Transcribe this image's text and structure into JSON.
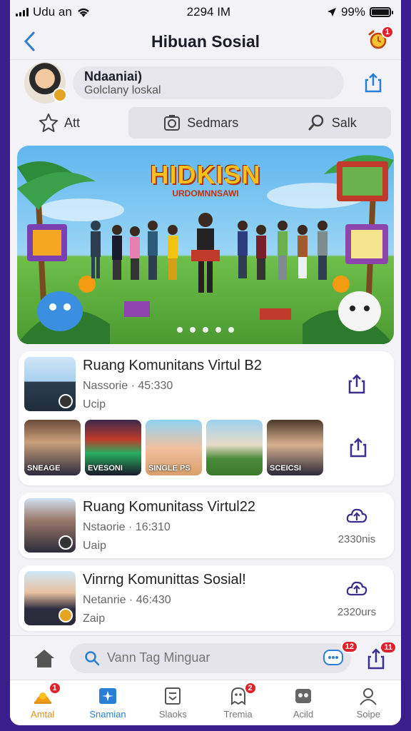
{
  "status": {
    "carrier": "Udu an",
    "time": "2294 IM",
    "battery": "99%",
    "battery_level": 0.99
  },
  "header": {
    "title": "Hibuan Sosial",
    "notif_badge": "1"
  },
  "profile": {
    "name": "Ndaaniai)",
    "subtitle": "Golclany loskal"
  },
  "tabs": {
    "first": "Att",
    "second": "Sedmars",
    "third": "Salk"
  },
  "banner": {
    "title": "HIDKISN",
    "subtitle": "URDOMNNSAWI",
    "slide_count": 5
  },
  "posts": [
    {
      "title": "Ruang Komunitans Virtul B2",
      "meta": "Nassorie · 45:330",
      "sub": "Ucip"
    },
    {
      "title": "Ruang Komunitass Virtul22",
      "meta": "Nstaorie · 16:310",
      "sub": "Uaip",
      "count": "2330nis"
    },
    {
      "title": "Vinrng Komunittas Sosial!",
      "meta": "Netanrie · 46:430",
      "sub": "Zaip",
      "count": "2320urs"
    }
  ],
  "gallery": [
    "SNEAGE",
    "EVESONI",
    "SINGLE PS",
    "",
    "SCEICSI"
  ],
  "search": {
    "placeholder": "Vann Tag Minguar",
    "chat_badge": "12",
    "right_badge": "11"
  },
  "nav": [
    {
      "label": "Amtal",
      "badge": "1"
    },
    {
      "label": "Snamian"
    },
    {
      "label": "Slaoks"
    },
    {
      "label": "Tremia",
      "badge": "2"
    },
    {
      "label": "Acild"
    },
    {
      "label": "Soipe"
    }
  ],
  "colors": {
    "accent": "#2a7fd4",
    "active_nav": "#e0901a",
    "badge": "#e0202a",
    "frame": "#3a1f8c",
    "icon_outline": "#3a2f8c"
  }
}
